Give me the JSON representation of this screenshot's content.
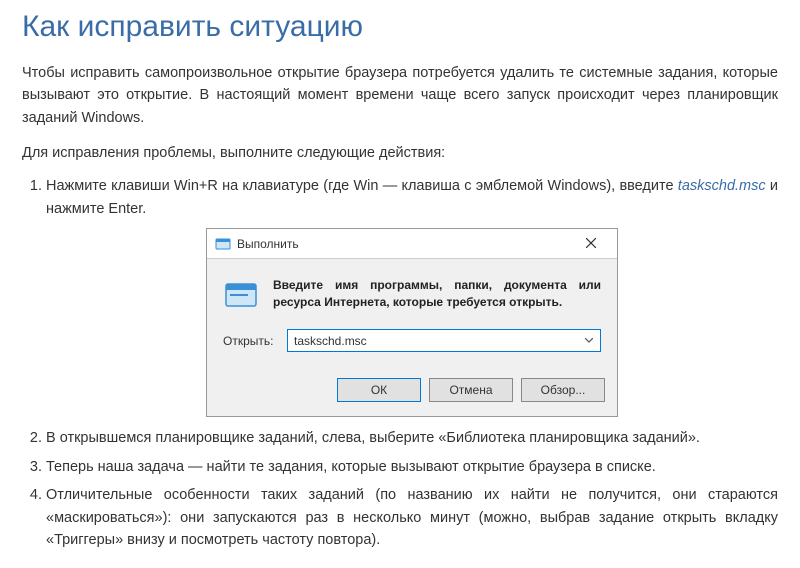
{
  "heading": "Как исправить ситуацию",
  "intro": "Чтобы исправить самопроизвольное открытие браузера потребуется удалить те системные задания, которые вызывают это открытие. В настоящий момент времени чаще всего запуск происходит через планировщик заданий Windows.",
  "instruction": "Для исправления проблемы, выполните следующие действия:",
  "steps": {
    "s1a": "Нажмите клавиши Win+R на клавиатуре (где Win — клавиша с эмблемой Windows), введите ",
    "s1cmd": "taskschd.msc",
    "s1b": " и нажмите Enter.",
    "s2": "В открывшемся планировщике заданий, слева, выберите «Библиотека планировщика заданий».",
    "s3": "Теперь наша задача — найти те задания, которые вызывают открытие браузера в списке.",
    "s4": "Отличительные особенности таких заданий (по названию их найти не получится, они стараются «маскироваться»): они запускаются раз в несколько минут (можно, выбрав задание открыть вкладку «Триггеры» внизу и посмотреть частоту повтора)."
  },
  "dialog": {
    "title": "Выполнить",
    "description": "Введите имя программы, папки, документа или ресурса Интернета, которые требуется открыть.",
    "open_label": "Открыть:",
    "value": "taskschd.msc",
    "ok": "ОК",
    "cancel": "Отмена",
    "browse": "Обзор..."
  }
}
